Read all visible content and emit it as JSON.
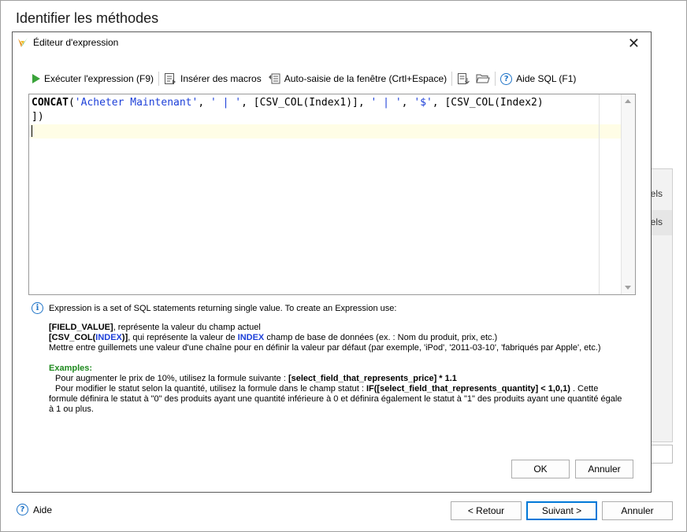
{
  "window": {
    "title": "Identifier les méthodes"
  },
  "background_panel": {
    "row1": "eels",
    "row2": "eels"
  },
  "footer": {
    "help_label": "Aide",
    "back_label": "< Retour",
    "next_label": "Suivant >",
    "cancel_label": "Annuler"
  },
  "dialog": {
    "title": "Éditeur d'expression",
    "close_glyph": "✕",
    "toolbar": {
      "execute_label": "Exécuter l'expression (F9)",
      "insert_macros_label": "Insérer des macros",
      "autocomplete_label": "Auto-saisie de la fenêtre (Crtl+Espace)",
      "sql_help_label": "Aide SQL (F1)"
    },
    "editor": {
      "line1": {
        "kw": "CONCAT",
        "p1": "(",
        "s1": "'Acheter Maintenant'",
        "p2": ", ",
        "s2": "' | '",
        "p3": ", [CSV_COL(Index1)], ",
        "s3": "' | '",
        "p4": ", ",
        "s4": "'$'",
        "p5": ", [CSV_COL(Index2)"
      },
      "line2": "])"
    },
    "info": {
      "header": "Expression is a set of SQL statements returning single value. To create an Expression use:",
      "field_value_token": "[FIELD_VALUE]",
      "field_value_desc": ", représente la valeur du champ actuel",
      "csv_prefix": "[CSV_COL(",
      "csv_index": "INDEX",
      "csv_suffix": ")]",
      "csv_desc1": ", qui représente la valeur de ",
      "csv_index2": "INDEX",
      "csv_desc2": " champ de base de données (ex. : Nom du produit, prix, etc.)",
      "quotes_desc": "Mettre entre guillemets une valeur d'une chaîne pour en définir la valeur par défaut (par exemple, 'iPod', '2011-03-10', 'fabriqués par Apple', etc.)",
      "examples_label": "Examples:",
      "ex1_text": "Pour augmenter le prix de 10%, utilisez la formule suivante : ",
      "ex1_formula": "[select_field_that_represents_price] * 1.1",
      "ex2_text": "Pour modifier le statut selon la quantité, utilisez la formule dans le champ statut : ",
      "ex2_formula": "IF([select_field_that_represents_quantity] < 1,0,1)",
      "ex2_rest": " . Cette formule définira le statut à \"0\" des produits ayant une quantité inférieure à 0 et définira également le statut à \"1\" des produits ayant une quantité égale à 1 ou plus."
    },
    "ok_label": "OK",
    "cancel_label": "Annuler"
  },
  "colors": {
    "accent": "#0078d7",
    "string": "#1c3fd8",
    "example": "#1f8a1f",
    "run": "#3aa33a"
  }
}
